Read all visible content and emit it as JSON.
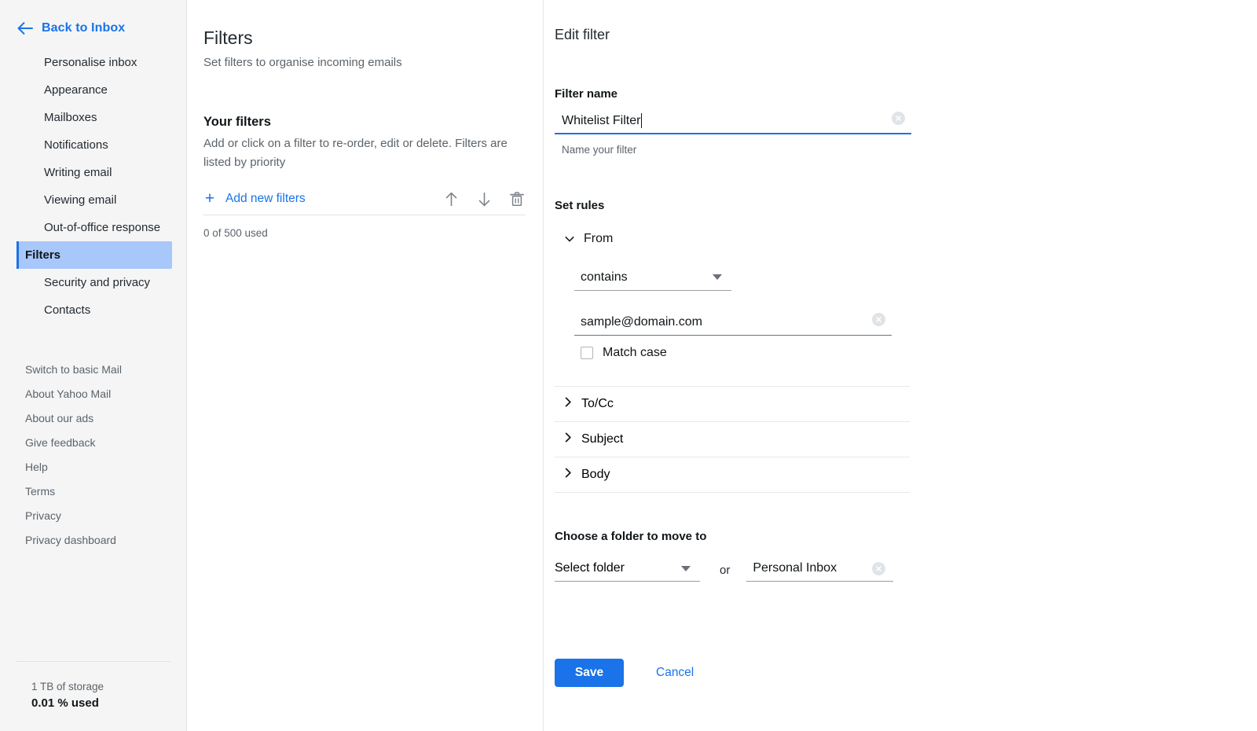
{
  "sidebar": {
    "back": {
      "label": "Back to Inbox",
      "icon": "arrow-left-icon"
    },
    "items": [
      {
        "label": "Personalise inbox",
        "active": false
      },
      {
        "label": "Appearance",
        "active": false
      },
      {
        "label": "Mailboxes",
        "active": false
      },
      {
        "label": "Notifications",
        "active": false
      },
      {
        "label": "Writing email",
        "active": false
      },
      {
        "label": "Viewing email",
        "active": false
      },
      {
        "label": "Out-of-office response",
        "active": false
      },
      {
        "label": "Filters",
        "active": true
      },
      {
        "label": "Security and privacy",
        "active": false
      },
      {
        "label": "Contacts",
        "active": false
      }
    ],
    "links": [
      {
        "label": "Switch to basic Mail"
      },
      {
        "label": "About Yahoo Mail"
      },
      {
        "label": "About our ads"
      },
      {
        "label": "Give feedback"
      },
      {
        "label": "Help"
      },
      {
        "label": "Terms"
      },
      {
        "label": "Privacy"
      },
      {
        "label": "Privacy dashboard"
      }
    ],
    "storage": {
      "total": "1 TB of storage",
      "used": "0.01 % used"
    }
  },
  "middle": {
    "title": "Filters",
    "subtitle": "Set filters to organise incoming emails",
    "your_filters_title": "Your filters",
    "your_filters_desc": "Add or click on a filter to re-order, edit or delete. Filters are listed by priority",
    "add_filters_label": "Add new filters",
    "icons": {
      "plus": "+",
      "move_up": "move-up-icon",
      "move_down": "move-down-icon",
      "delete": "trash-icon"
    },
    "used_count": "0 of 500 used"
  },
  "edit_filter": {
    "title": "Edit filter",
    "name_label": "Filter name",
    "name_value": "Whitelist Filter",
    "name_placeholder": "Name your filter",
    "name_helper": "Name your filter",
    "rules_label": "Set rules",
    "rules": [
      {
        "name": "From",
        "expanded": true,
        "condition": "contains",
        "value": "sample@domain.com",
        "match_case_label": "Match case",
        "match_case_checked": false
      },
      {
        "name": "To/Cc",
        "expanded": false
      },
      {
        "name": "Subject",
        "expanded": false
      },
      {
        "name": "Body",
        "expanded": false
      }
    ],
    "folder_label": "Choose a folder to move to",
    "folder_select_placeholder": "Select folder",
    "or_word": "or",
    "folder_value": "Personal Inbox",
    "save_label": "Save",
    "cancel_label": "Cancel"
  },
  "colors": {
    "accent": "#1a73e8",
    "active_nav_bg": "#a8c7fa",
    "sidebar_bg": "#f5f5f5",
    "muted_text": "#5b636a"
  }
}
